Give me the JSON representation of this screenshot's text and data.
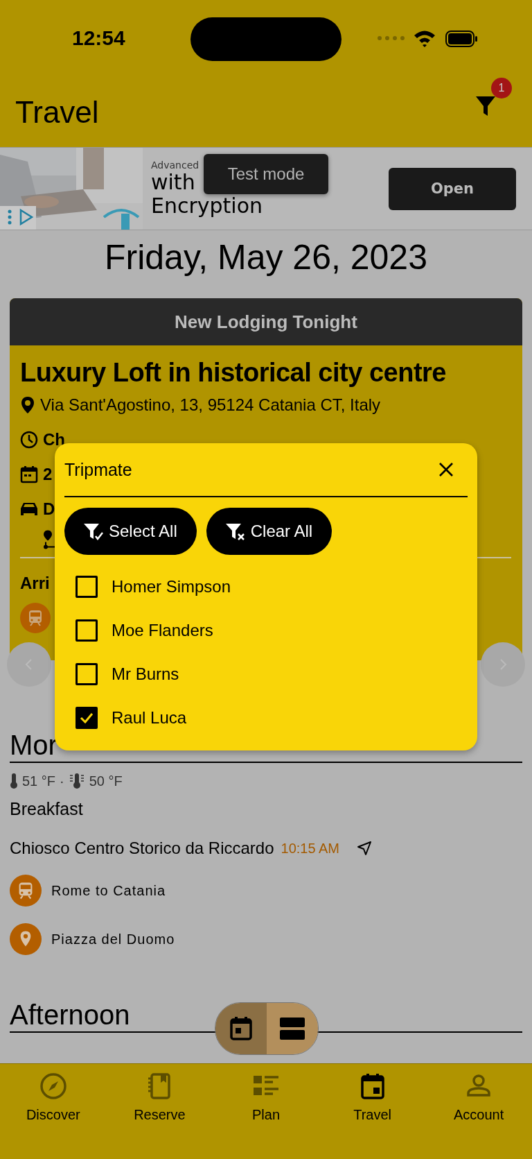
{
  "status_bar": {
    "time": "12:54"
  },
  "header": {
    "title": "Travel",
    "filter_badge": "1"
  },
  "ad": {
    "line_1": "Advanced",
    "line_2": "with",
    "line_3": "Encryption",
    "button": "Open",
    "toast": "Test mode"
  },
  "date_heading": "Friday, May 26, 2023",
  "lodging_card": {
    "banner": "New Lodging Tonight",
    "name": "Luxury Loft in historical city centre",
    "address": "Via Sant'Agostino, 13, 95124 Catania CT, Italy",
    "check_in": "Ch",
    "date": "2",
    "drive": "D",
    "arrival": "Arri"
  },
  "tripmate_dialog": {
    "title": "Tripmate",
    "buttons": [
      {
        "label": "Select All",
        "kind": "select"
      },
      {
        "label": "Clear All",
        "kind": "clear"
      }
    ],
    "people": [
      {
        "name": "Homer Simpson",
        "checked": false
      },
      {
        "name": "Moe Flanders",
        "checked": false
      },
      {
        "name": "Mr Burns",
        "checked": false
      },
      {
        "name": "Raul Luca",
        "checked": true
      }
    ]
  },
  "morning": {
    "heading": "Mor",
    "temperature": "51 °F",
    "separator": "·",
    "feels_like": "50 °F",
    "meal": "Breakfast",
    "place": "Chiosco Centro Storico da Riccardo",
    "time": "10:15 AM",
    "items": [
      {
        "kind": "train",
        "label": "Rome to Catania"
      },
      {
        "kind": "pin",
        "label": "Piazza del Duomo"
      }
    ]
  },
  "afternoon": {
    "heading": "Afternoon"
  },
  "view_toggle": [
    {
      "kind": "calendar",
      "selected": false
    },
    {
      "kind": "list",
      "selected": true
    }
  ],
  "tab_bar": [
    {
      "label": "Discover",
      "kind": "compass",
      "selected": false
    },
    {
      "label": "Reserve",
      "kind": "book",
      "selected": false
    },
    {
      "label": "Plan",
      "kind": "plan",
      "selected": false
    },
    {
      "label": "Travel",
      "kind": "calendar",
      "selected": true
    },
    {
      "label": "Account",
      "kind": "person",
      "selected": false
    }
  ]
}
